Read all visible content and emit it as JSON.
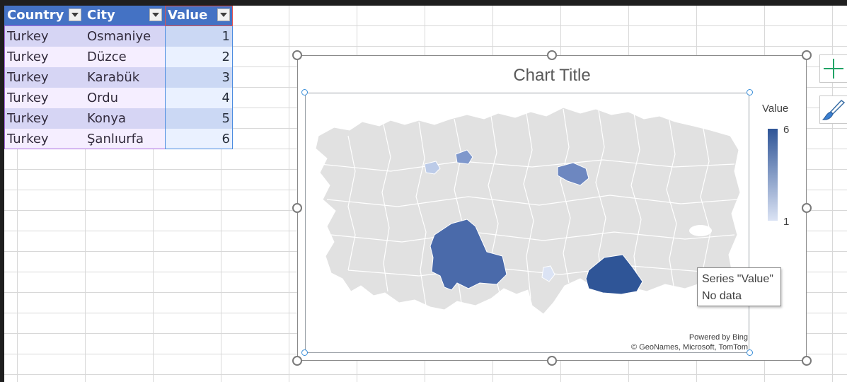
{
  "table": {
    "headers": [
      "Country",
      "City",
      "Value"
    ],
    "rows": [
      {
        "country": "Turkey",
        "city": "Osmaniye",
        "value": "1"
      },
      {
        "country": "Turkey",
        "city": "Düzce",
        "value": "2"
      },
      {
        "country": "Turkey",
        "city": "Karabük",
        "value": "3"
      },
      {
        "country": "Turkey",
        "city": "Ordu",
        "value": "4"
      },
      {
        "country": "Turkey",
        "city": "Konya",
        "value": "5"
      },
      {
        "country": "Turkey",
        "city": "Şanlıurfa",
        "value": "6"
      }
    ]
  },
  "chart": {
    "title": "Chart Title",
    "legend_title": "Value",
    "legend_max": "6",
    "legend_min": "1",
    "powered_by": "Powered by Bing",
    "attribution": "© GeoNames, Microsoft, TomTom",
    "tooltip_line1": "Series \"Value\"",
    "tooltip_line2": "No data"
  },
  "colors": {
    "header_blue": "#4472c4",
    "row_band": "#d9e1f2",
    "map_base": "#e1e1e1",
    "scale_high": "#2f5597",
    "scale_low": "#dbe3f4"
  },
  "icons": {
    "add_element": "plus-icon",
    "chart_styles": "paintbrush-icon"
  }
}
